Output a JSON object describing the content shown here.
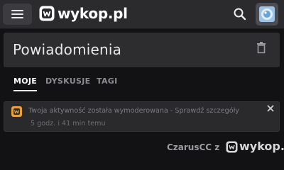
{
  "header": {
    "logo_text": "wykop.pl",
    "menu_icon": "hamburger-icon",
    "search_icon": "search-icon",
    "avatar_icon": "avatar"
  },
  "page": {
    "title": "Powiadomienia",
    "delete_icon": "trash-icon"
  },
  "tabs": [
    {
      "label": "MOJE",
      "active": true
    },
    {
      "label": "DYSKUSJE",
      "active": false
    },
    {
      "label": "TAGI",
      "active": false
    }
  ],
  "notification": {
    "text": "Twoja aktywność została wymoderowana - Sprawdź szczegóły",
    "time": "5 godz. i 41 min temu",
    "close_icon": "close-icon"
  },
  "watermark": {
    "author": "CzarusCC z",
    "site": "wykop.pl"
  },
  "colors": {
    "background": "#121214",
    "topbar": "#2b2b2e",
    "card": "#2d2d30",
    "accent_orange": "#e7a13c"
  }
}
